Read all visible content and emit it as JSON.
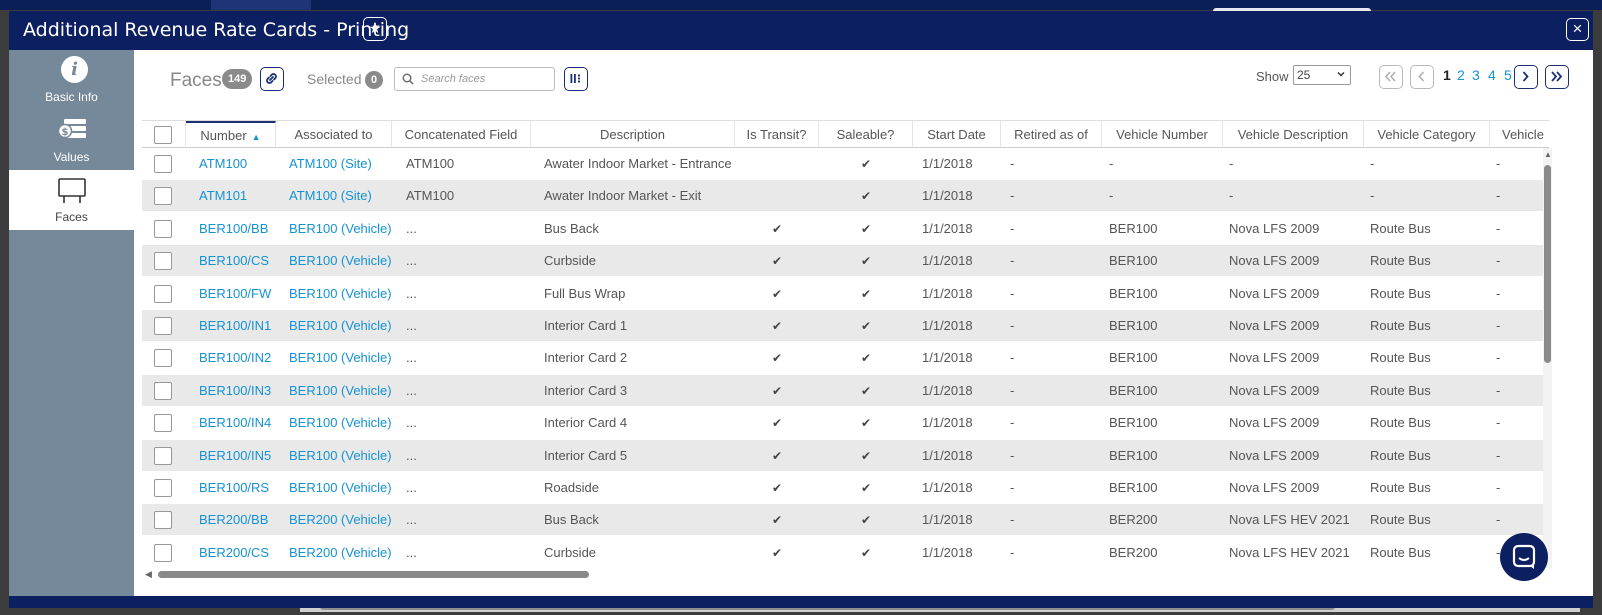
{
  "modal": {
    "title": "Additional Revenue Rate Cards - Printing",
    "star_icon": "star-icon",
    "close_icon": "close-icon",
    "close_glyph": "×",
    "star_glyph": "★"
  },
  "sidebar": {
    "items": [
      {
        "label": "Basic Info",
        "icon": "info-icon",
        "active": false
      },
      {
        "label": "Values",
        "icon": "money-icon",
        "active": false
      },
      {
        "label": "Faces",
        "icon": "billboard-icon",
        "active": true
      }
    ]
  },
  "toolbar": {
    "title": "Faces",
    "count": "149",
    "selected_label": "Selected",
    "selected_count": "0",
    "search_placeholder": "Search faces",
    "show_label": "Show",
    "show_value": "25"
  },
  "pagination": {
    "pages": [
      "1",
      "2",
      "3",
      "4",
      "5"
    ],
    "current": "1"
  },
  "table": {
    "columns": [
      "Number",
      "Associated to",
      "Concatenated Field",
      "Description",
      "Is Transit?",
      "Saleable?",
      "Start Date",
      "Retired as of",
      "Vehicle Number",
      "Vehicle Description",
      "Vehicle Category",
      "Vehicle"
    ],
    "sort_indicator": "▲",
    "check_glyph": "✔",
    "rows": [
      {
        "number": "ATM100",
        "associated": "ATM100 (Site)",
        "concat": "ATM100",
        "description": "Awater Indoor Market - Entrance",
        "transit": false,
        "saleable": true,
        "start": "1/1/2018",
        "retired": "-",
        "vnum": "-",
        "vdesc": "-",
        "vcat": "-",
        "vehicle": "-"
      },
      {
        "number": "ATM101",
        "associated": "ATM100 (Site)",
        "concat": "ATM100",
        "description": "Awater Indoor Market - Exit",
        "transit": false,
        "saleable": true,
        "start": "1/1/2018",
        "retired": "-",
        "vnum": "-",
        "vdesc": "-",
        "vcat": "-",
        "vehicle": "-"
      },
      {
        "number": "BER100/BB",
        "associated": "BER100 (Vehicle)",
        "concat": "...",
        "description": "Bus Back",
        "transit": true,
        "saleable": true,
        "start": "1/1/2018",
        "retired": "-",
        "vnum": "BER100",
        "vdesc": "Nova LFS 2009",
        "vcat": "Route Bus",
        "vehicle": "-"
      },
      {
        "number": "BER100/CS",
        "associated": "BER100 (Vehicle)",
        "concat": "...",
        "description": "Curbside",
        "transit": true,
        "saleable": true,
        "start": "1/1/2018",
        "retired": "-",
        "vnum": "BER100",
        "vdesc": "Nova LFS 2009",
        "vcat": "Route Bus",
        "vehicle": "-"
      },
      {
        "number": "BER100/FW",
        "associated": "BER100 (Vehicle)",
        "concat": "...",
        "description": "Full Bus Wrap",
        "transit": true,
        "saleable": true,
        "start": "1/1/2018",
        "retired": "-",
        "vnum": "BER100",
        "vdesc": "Nova LFS 2009",
        "vcat": "Route Bus",
        "vehicle": "-"
      },
      {
        "number": "BER100/IN1",
        "associated": "BER100 (Vehicle)",
        "concat": "...",
        "description": "Interior Card 1",
        "transit": true,
        "saleable": true,
        "start": "1/1/2018",
        "retired": "-",
        "vnum": "BER100",
        "vdesc": "Nova LFS 2009",
        "vcat": "Route Bus",
        "vehicle": "-"
      },
      {
        "number": "BER100/IN2",
        "associated": "BER100 (Vehicle)",
        "concat": "...",
        "description": "Interior Card 2",
        "transit": true,
        "saleable": true,
        "start": "1/1/2018",
        "retired": "-",
        "vnum": "BER100",
        "vdesc": "Nova LFS 2009",
        "vcat": "Route Bus",
        "vehicle": "-"
      },
      {
        "number": "BER100/IN3",
        "associated": "BER100 (Vehicle)",
        "concat": "...",
        "description": "Interior Card 3",
        "transit": true,
        "saleable": true,
        "start": "1/1/2018",
        "retired": "-",
        "vnum": "BER100",
        "vdesc": "Nova LFS 2009",
        "vcat": "Route Bus",
        "vehicle": "-"
      },
      {
        "number": "BER100/IN4",
        "associated": "BER100 (Vehicle)",
        "concat": "...",
        "description": "Interior Card 4",
        "transit": true,
        "saleable": true,
        "start": "1/1/2018",
        "retired": "-",
        "vnum": "BER100",
        "vdesc": "Nova LFS 2009",
        "vcat": "Route Bus",
        "vehicle": "-"
      },
      {
        "number": "BER100/IN5",
        "associated": "BER100 (Vehicle)",
        "concat": "...",
        "description": "Interior Card 5",
        "transit": true,
        "saleable": true,
        "start": "1/1/2018",
        "retired": "-",
        "vnum": "BER100",
        "vdesc": "Nova LFS 2009",
        "vcat": "Route Bus",
        "vehicle": "-"
      },
      {
        "number": "BER100/RS",
        "associated": "BER100 (Vehicle)",
        "concat": "...",
        "description": "Roadside",
        "transit": true,
        "saleable": true,
        "start": "1/1/2018",
        "retired": "-",
        "vnum": "BER100",
        "vdesc": "Nova LFS 2009",
        "vcat": "Route Bus",
        "vehicle": "-"
      },
      {
        "number": "BER200/BB",
        "associated": "BER200 (Vehicle)",
        "concat": "...",
        "description": "Bus Back",
        "transit": true,
        "saleable": true,
        "start": "1/1/2018",
        "retired": "-",
        "vnum": "BER200",
        "vdesc": "Nova LFS HEV 2021",
        "vcat": "Route Bus",
        "vehicle": "-"
      },
      {
        "number": "BER200/CS",
        "associated": "BER200 (Vehicle)",
        "concat": "...",
        "description": "Curbside",
        "transit": true,
        "saleable": true,
        "start": "1/1/2018",
        "retired": "-",
        "vnum": "BER200",
        "vdesc": "Nova LFS HEV 2021",
        "vcat": "Route Bus",
        "vehicle": "-"
      }
    ]
  },
  "colors": {
    "header_navy": "#0c1f61",
    "sidebar": "#76899b",
    "link": "#1592d4",
    "row_alt": "#e9e9e9"
  },
  "chat": {
    "icon": "chat-icon"
  }
}
